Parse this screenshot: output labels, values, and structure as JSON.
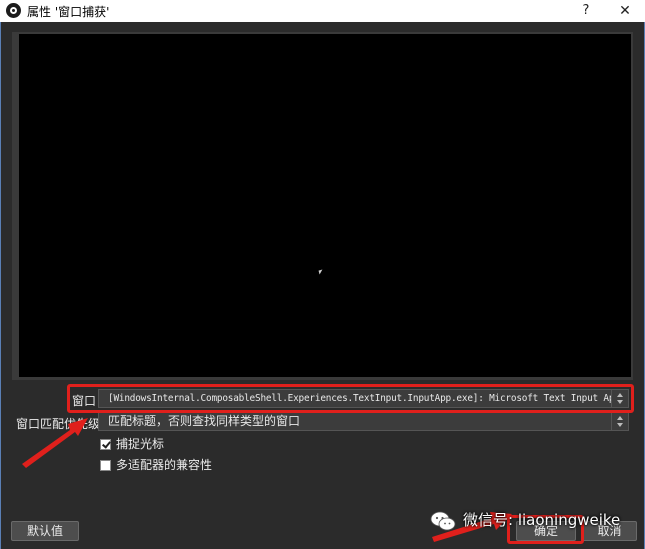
{
  "window": {
    "title": "属性 '窗口捕获'",
    "help_symbol": "?",
    "close_symbol": "✕"
  },
  "form": {
    "window_label": "窗口",
    "window_value": "[WindowsInternal.ComposableShell.Experiences.TextInput.InputApp.exe]: Microsoft Text Input Ap",
    "priority_label": "窗口匹配优先级",
    "priority_value": "匹配标题，否则查找同样类型的窗口",
    "capture_cursor_label": "捕捉光标",
    "capture_cursor_checked": true,
    "multi_adapter_label": "多适配器的兼容性",
    "multi_adapter_checked": false
  },
  "buttons": {
    "defaults": "默认值",
    "ok": "确定",
    "cancel": "取消"
  },
  "watermark": {
    "text": "微信号: liaoningweike"
  },
  "icons": [
    "obs-app-icon",
    "help-icon",
    "close-icon",
    "mouse-cursor-icon",
    "dropdown-spin-icon",
    "wechat-icon"
  ],
  "colors": {
    "dialog_bg": "#2b2b2b",
    "preview_bg": "#000000",
    "annotation_red": "#e0201c"
  }
}
